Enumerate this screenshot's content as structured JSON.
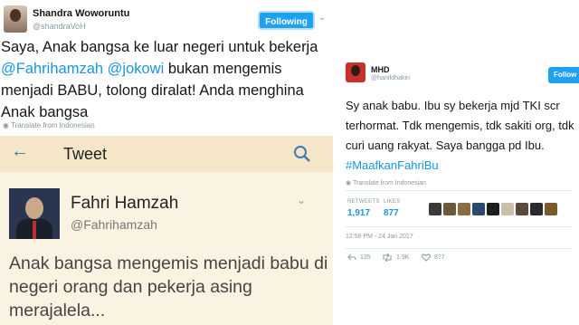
{
  "left_tweet": {
    "author_name": "Shandra Woworuntu",
    "author_handle": "@shandraVoH",
    "follow_label": "Following",
    "text_parts": {
      "p1": "Saya, Anak bangsa ke luar negeri untuk bekerja ",
      "m1": "@Fahrihamzah",
      "sp": " ",
      "m2": "@jokowi",
      "p2": "  bukan mengemis menjadi BABU, tolong diralat! Anda menghina Anak bangsa"
    },
    "translate_label": "Translate from Indonesian"
  },
  "embedded_screenshot": {
    "bar_title": "Tweet",
    "author_name": "Fahri Hamzah",
    "author_handle": "@Fahrihamzah",
    "text": "Anak bangsa mengemis menjadi babu di negeri orang dan pekerja asing merajalela..."
  },
  "right_tweet": {
    "author_name": "MHD",
    "author_handle": "@hanifdhakiri",
    "follow_label": "Follow",
    "text": "Sy anak babu. Ibu sy bekerja mjd TKI scr terhormat. Tdk mengemis, tdk sakiti org, tdk curi uang rakyat. Saya bangga pd Ibu.",
    "hashtag": "#MaafkanFahriBu",
    "translate_label": "Translate from Indonesian",
    "retweets_label": "RETWEETS",
    "retweets_value": "1,917",
    "likes_label": "LIKES",
    "likes_value": "877",
    "timestamp": "12:58 PM - 24 Jan 2017",
    "reply_count": "135",
    "retweet_count": "1.9K",
    "like_count": "877"
  },
  "colors": {
    "twitter_blue": "#1da1f2",
    "link_blue": "#1b95e0",
    "embed_bg": "#fbf3e2",
    "embed_bar": "#f5e6c8"
  }
}
